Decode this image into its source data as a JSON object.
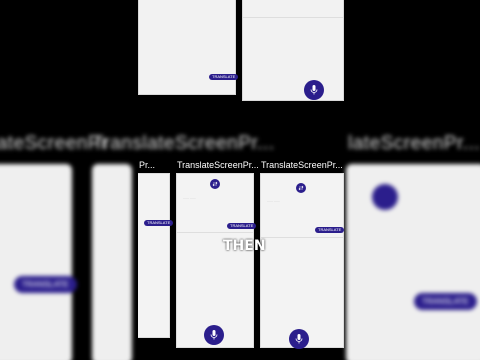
{
  "ghost": {
    "title_left": "TranslateScreenPr...",
    "title_right": "lateScreenPr...",
    "button_left": "TRANSLATE",
    "button_right": "TRANSLATE"
  },
  "top": {
    "translate_button": "TRANSLATE"
  },
  "screens": [
    {
      "title": "TranslateScreenPr...",
      "translate_button": "TRANSLATE"
    },
    {
      "title": "TranslateScreenPr...",
      "translate_button": "TRANSLATE"
    },
    {
      "title": "TranslateScreenPr...",
      "translate_button": "TRANSLATE"
    }
  ],
  "caption": "THEN",
  "colors": {
    "accent": "#2b1e8c",
    "screen_bg": "#f3f3f3"
  }
}
